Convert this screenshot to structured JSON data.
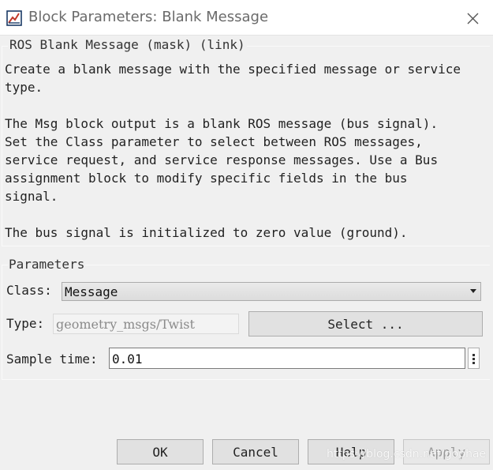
{
  "window": {
    "title": "Block Parameters: Blank Message",
    "close_icon": "close-icon",
    "app_icon": "simulink-block-icon"
  },
  "description": {
    "group_title": "ROS Blank Message (mask) (link)",
    "text": "Create a blank message with the specified message or service\ntype.\n\nThe Msg block output is a blank ROS message (bus signal).\nSet the Class parameter to select between ROS messages,\nservice request, and service response messages. Use a Bus\nassignment block to modify specific fields in the bus\nsignal.\n\nThe bus signal is initialized to zero value (ground)."
  },
  "parameters": {
    "group_title": "Parameters",
    "class_label": "Class:",
    "class_value": "Message",
    "type_label": "Type:",
    "type_value": "geometry_msgs/Twist",
    "select_button": "Select ...",
    "sample_time_label": "Sample time:",
    "sample_time_value": "0.01"
  },
  "buttons": {
    "ok": "OK",
    "cancel": "Cancel",
    "help": "Help",
    "apply": "Apply"
  },
  "watermark": "https://blog.csdn.net/gophae",
  "colors": {
    "background": "#f0f0f0",
    "title_bar": "#ffffff",
    "button_face": "#e1e1e1",
    "button_border": "#adadad"
  }
}
